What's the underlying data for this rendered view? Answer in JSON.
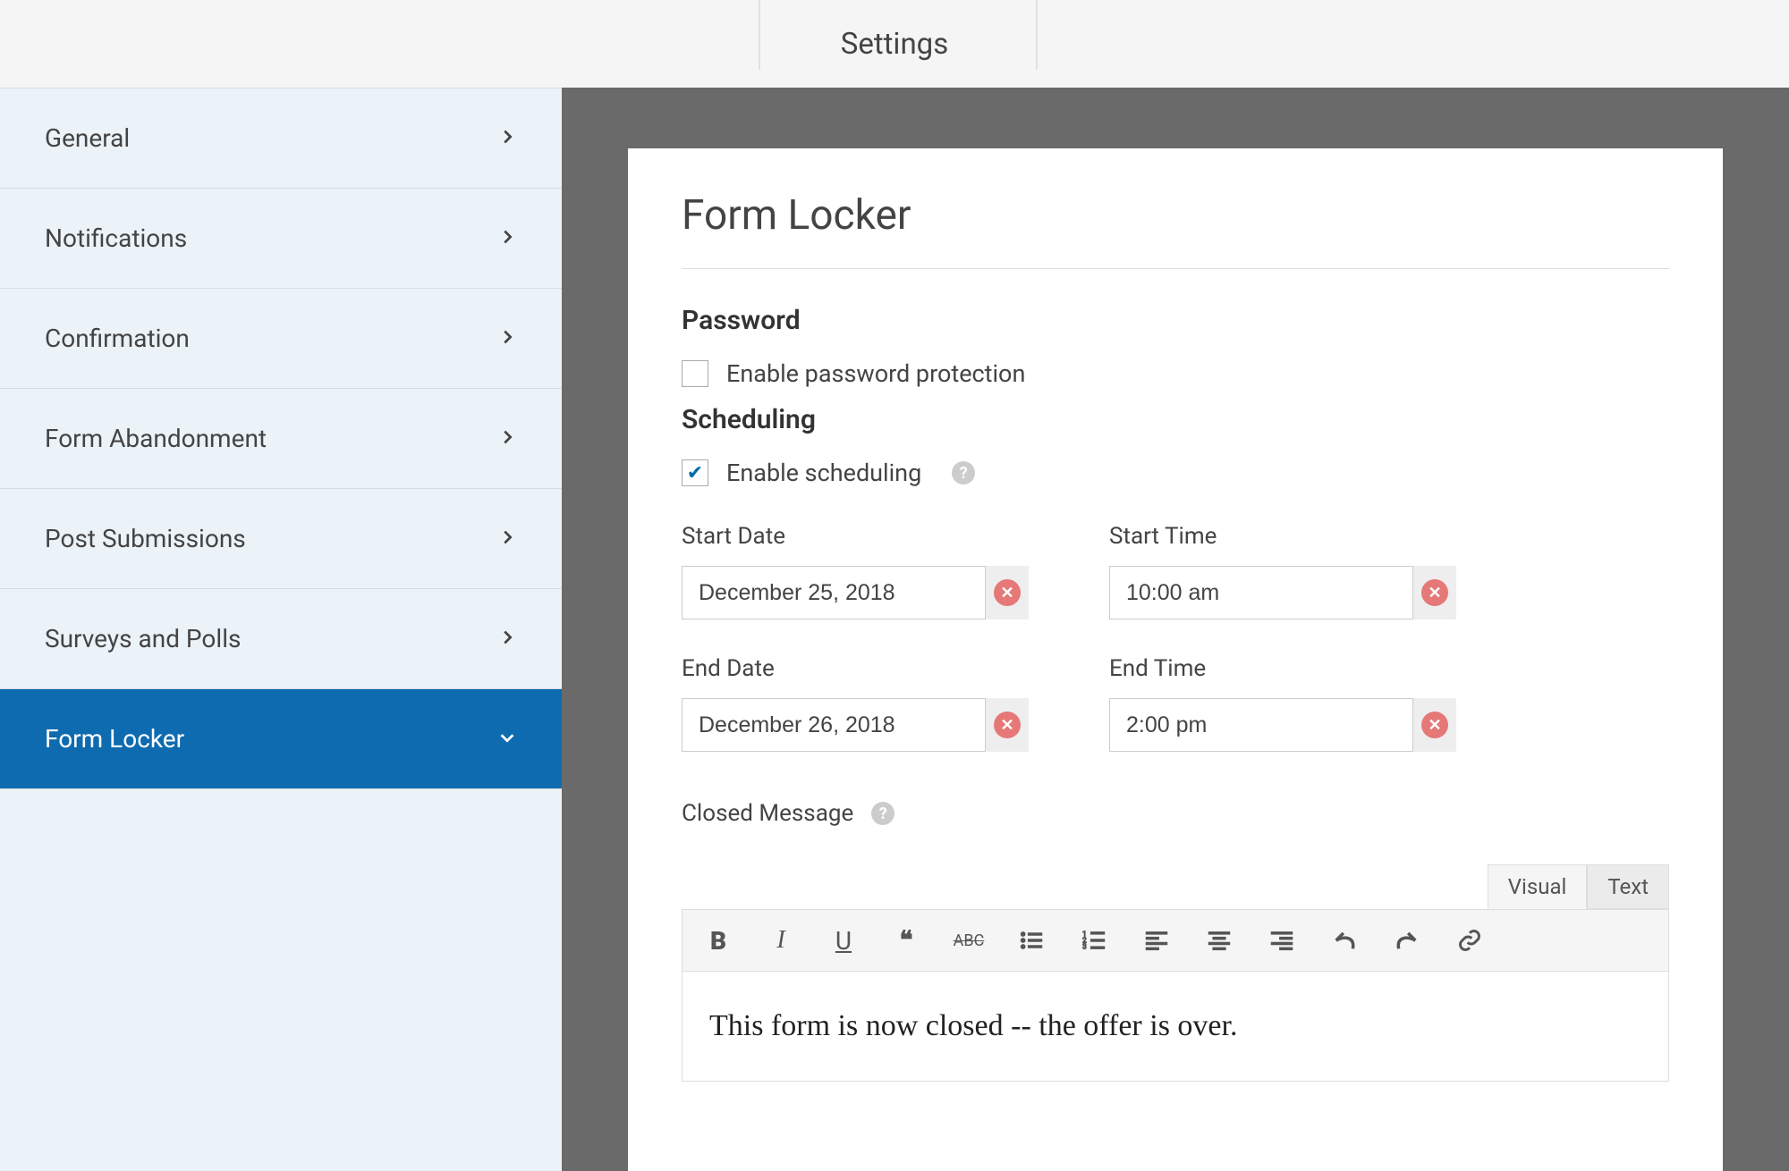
{
  "topbar": {
    "title": "Settings"
  },
  "sidebar": {
    "items": [
      {
        "label": "General"
      },
      {
        "label": "Notifications"
      },
      {
        "label": "Confirmation"
      },
      {
        "label": "Form Abandonment"
      },
      {
        "label": "Post Submissions"
      },
      {
        "label": "Surveys and Polls"
      },
      {
        "label": "Form Locker"
      }
    ]
  },
  "panel": {
    "title": "Form Locker",
    "password": {
      "heading": "Password",
      "enable_label": "Enable password protection",
      "enabled": false
    },
    "scheduling": {
      "heading": "Scheduling",
      "enable_label": "Enable scheduling",
      "enabled": true,
      "start_date_label": "Start Date",
      "start_date": "December 25, 2018",
      "start_time_label": "Start Time",
      "start_time": "10:00 am",
      "end_date_label": "End Date",
      "end_date": "December 26, 2018",
      "end_time_label": "End Time",
      "end_time": "2:00 pm",
      "closed_message_label": "Closed Message",
      "closed_message": "This form is now closed -- the offer is over."
    },
    "editor": {
      "tabs": {
        "visual": "Visual",
        "text": "Text",
        "active": "visual"
      }
    }
  }
}
